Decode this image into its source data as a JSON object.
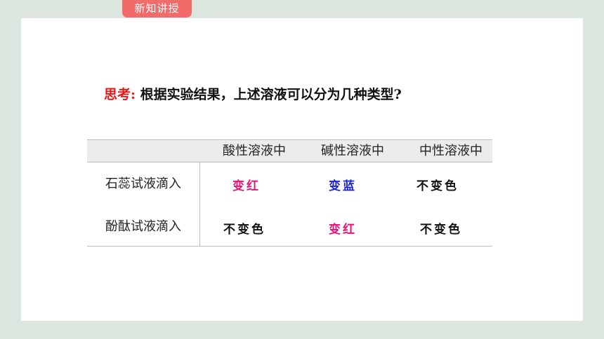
{
  "tag_label": "新知讲授",
  "question": {
    "lead": "思考:",
    "text": "根据实验结果，上述溶液可以分为几种类型?"
  },
  "table": {
    "columns": [
      "酸性溶液中",
      "碱性溶液中",
      "中性溶液中"
    ],
    "rows": [
      {
        "label": "石蕊试液滴入",
        "cells": [
          "变红",
          "变蓝",
          "不变色"
        ]
      },
      {
        "label": "酚酞试液滴入",
        "cells": [
          "不变色",
          "变红",
          "不变色"
        ]
      }
    ]
  },
  "colors": {
    "red_result": "#e8137a",
    "blue_result": "#1b22e0",
    "neutral_result": "#111111",
    "tag": "#f26b6b",
    "question_lead": "#e21a1a"
  }
}
